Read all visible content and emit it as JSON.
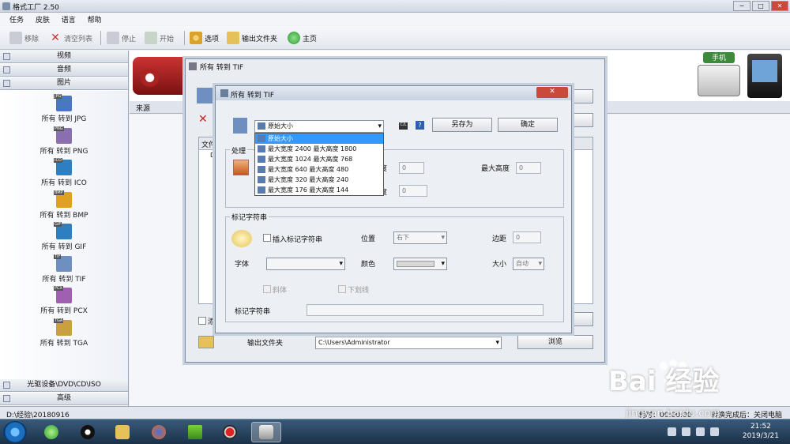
{
  "app": {
    "title": "格式工厂 2.50",
    "menu": [
      "任务",
      "皮肤",
      "语言",
      "帮助"
    ],
    "toolbar": {
      "remove": "移除",
      "clear": "清空列表",
      "stop": "停止",
      "start": "开始",
      "options": "选项",
      "output_folder": "输出文件夹",
      "home": "主页"
    },
    "sidebar": {
      "categories": [
        "视频",
        "音频",
        "图片"
      ],
      "items": [
        {
          "tag": "JPG",
          "label": "所有 转到 JPG",
          "color": "#4a78c0"
        },
        {
          "tag": "PNG",
          "label": "所有 转到 PNG",
          "color": "#8a6fb0"
        },
        {
          "tag": "ICO",
          "label": "所有 转到 ICO",
          "color": "#2f7fc0"
        },
        {
          "tag": "BMP",
          "label": "所有 转到 BMP",
          "color": "#e0a020"
        },
        {
          "tag": "GIF",
          "label": "所有 转到 GIF",
          "color": "#2f7fc0"
        },
        {
          "tag": "TIF",
          "label": "所有 转到 TIF",
          "color": "#6f8fc0"
        },
        {
          "tag": "PCX",
          "label": "所有 转到 PCX",
          "color": "#a05fb0"
        },
        {
          "tag": "TGA",
          "label": "所有 转到 TGA",
          "color": "#c8a040"
        }
      ],
      "bottom_categories": [
        "光驱设备\\DVD\\CD\\ISO",
        "高级"
      ]
    },
    "source_label": "来源",
    "phone_label": "手机",
    "status": {
      "path": "D:\\经验\\20180916",
      "elapsed": "耗时：00:00:00",
      "after_done": "转换完成后：关闭电脑"
    }
  },
  "background_dialog": {
    "title": "所有 转到 TIF",
    "file_col": "文件",
    "file_row": "D",
    "add_label": "添",
    "output_folder_label": "输出文件夹",
    "output_path": "C:\\Users\\Administrator",
    "browse": "浏览"
  },
  "dialog": {
    "title": "所有 转到 TIF",
    "size_value": "原始大小",
    "save_as": "另存为",
    "ok": "确定",
    "process_group": "处理",
    "max_height_label": "最大高度",
    "max_height_value": "0",
    "partial_label_1": "度",
    "partial_value_1": "0",
    "partial_label_2": "度",
    "partial_value_2": "0",
    "mark_group": "标记字符串",
    "insert_mark": "插入标记字符串",
    "position_label": "位置",
    "position_value": "右下",
    "margin_label": "边距",
    "margin_value": "0",
    "font_label": "字体",
    "color_label": "颜色",
    "size_label": "大小",
    "size_auto": "自动",
    "italic": "斜体",
    "underline": "下划线",
    "mark_string_label": "标记字符串",
    "size_options": [
      "原始大小",
      "最大宽度 2400 最大高度 1800",
      "最大宽度 1024 最大高度 768",
      "最大宽度 640 最大高度 480",
      "最大宽度 320 最大高度 240",
      "最大宽度 176 最大高度 144"
    ]
  },
  "taskbar": {
    "time": "21:52",
    "date": "2019/3/21"
  },
  "watermark": {
    "brand": "Bai 经验",
    "url": "jingyan.baidu.com"
  }
}
